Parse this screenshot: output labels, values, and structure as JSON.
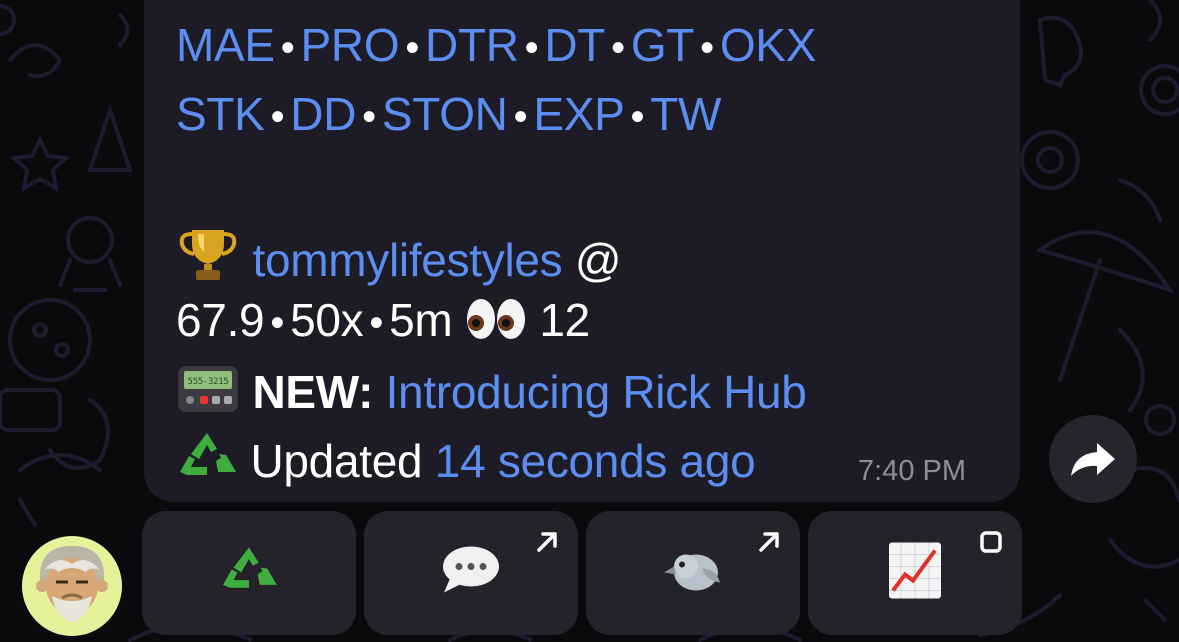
{
  "message": {
    "exchanges_row1": [
      "MAE",
      "PRO",
      "DTR",
      "DT",
      "GT",
      "OKX"
    ],
    "exchanges_row2": [
      "STK",
      "DD",
      "STON",
      "EXP",
      "TW"
    ],
    "separator": "•",
    "user": {
      "trophy_emoji": "trophy",
      "username": "tommylifestyles",
      "suffix": "@"
    },
    "stats": {
      "value": "67.9",
      "multiplier": "50x",
      "interval": "5m",
      "eyes_emoji": "eyes",
      "views": "12"
    },
    "news": {
      "icon": "pager-icon",
      "prefix": "NEW:",
      "link": "Introducing Rick Hub"
    },
    "update": {
      "icon": "recycle-icon",
      "prefix": "Updated",
      "link": "14 seconds ago"
    },
    "time": "7:40 PM"
  },
  "buttons": [
    {
      "icon": "recycle-icon",
      "corner": ""
    },
    {
      "icon": "speech-bubble-icon",
      "corner": "arrow-up-right-icon"
    },
    {
      "icon": "bird-icon",
      "corner": "arrow-up-right-icon"
    },
    {
      "icon": "chart-increasing-icon",
      "corner": "square-icon"
    }
  ],
  "colors": {
    "link": "#5b8ef0",
    "bubble": "#1d1c26",
    "button": "#24232c",
    "background": "#0a0a0c"
  }
}
